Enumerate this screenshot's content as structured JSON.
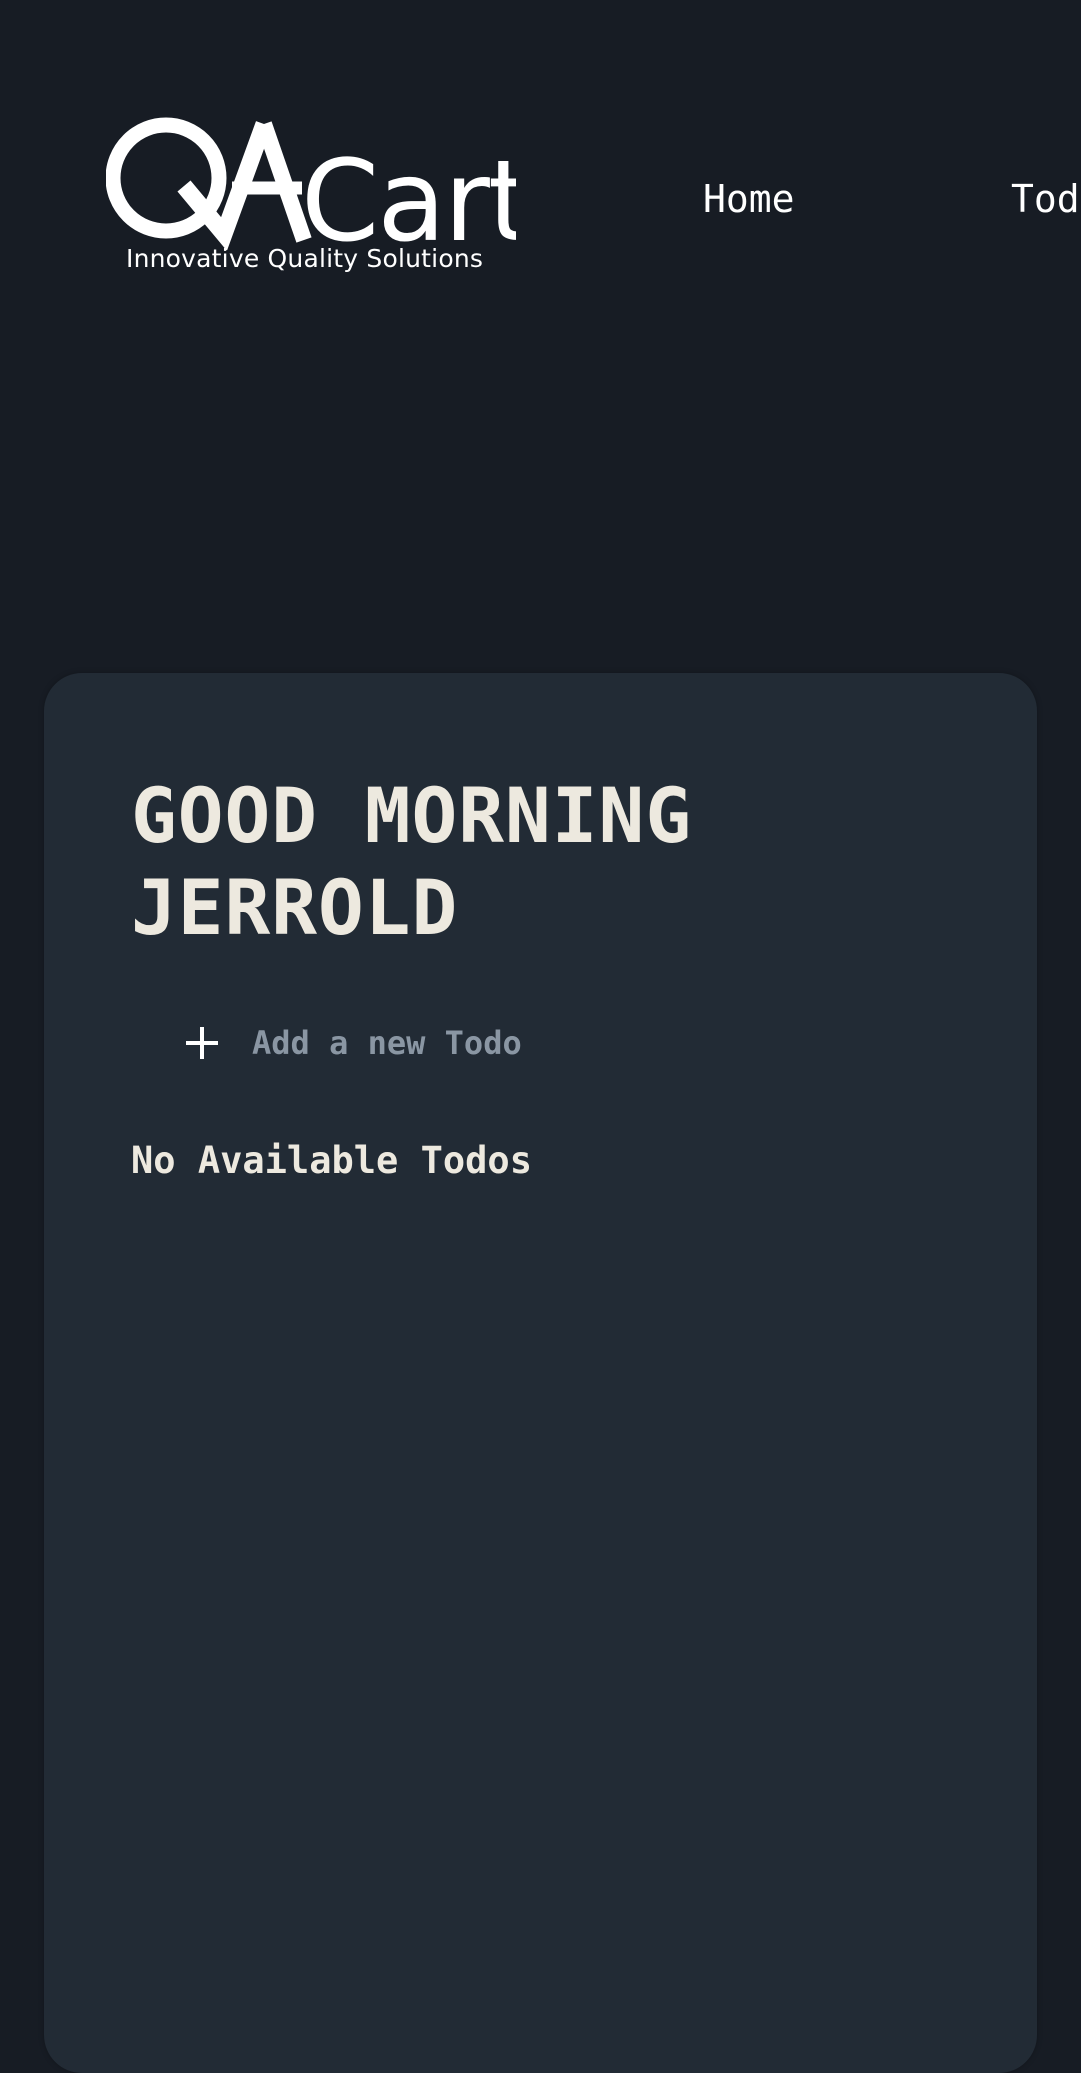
{
  "header": {
    "logo": {
      "text": "QACart",
      "tagline": "Innovative Quality Solutions"
    },
    "nav": {
      "home_label": "Home",
      "todo_label": "Todo"
    }
  },
  "main": {
    "greeting": "GOOD MORNING JERROLD",
    "add_todo": {
      "icon": "plus-icon",
      "placeholder": "Add a new Todo",
      "value": ""
    },
    "empty_message": "No Available Todos"
  },
  "colors": {
    "page_background": "#171c24",
    "card_background": "#222b35",
    "primary_text": "#ede9df",
    "placeholder_text": "#8a96a3",
    "nav_text": "#ffffff"
  }
}
